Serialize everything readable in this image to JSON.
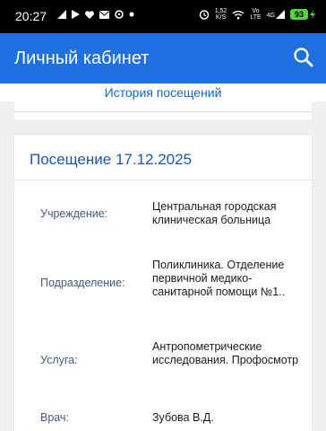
{
  "status_bar": {
    "time": "20:27",
    "speed_value": "1,52",
    "speed_unit": "K/S",
    "network_top": "Vo",
    "network_bottom": "LTE",
    "signal_label": "4G",
    "battery": "93",
    "left_icons": [
      "signal-bars-icon",
      "play-icon",
      "heart-icon",
      "mail-icon",
      "messenger-icon",
      "dot-icon"
    ],
    "right_icons": [
      "alarm-icon",
      "wifi-icon",
      "cell-signal-icon",
      "battery-icon"
    ]
  },
  "app_bar": {
    "title": "Личный кабинет",
    "search_icon": "search-icon",
    "background": "#1e6fe0"
  },
  "subheader": {
    "label": "История посещений",
    "color": "#1467c8"
  },
  "visit": {
    "title": "Посещение 17.12.2025",
    "fields": [
      {
        "label": "Учреждение:",
        "value": "Центральная городская клиническая больница"
      },
      {
        "label": "Подразделение:",
        "value": "Поликлиника. Отделение первичной медико-санитарной помощи №1.."
      },
      {
        "label": "Услуга:",
        "value": "Антропометрические исследования. Профосмотр"
      },
      {
        "label": "Врач:",
        "value": "Зубова В.Д."
      }
    ]
  }
}
